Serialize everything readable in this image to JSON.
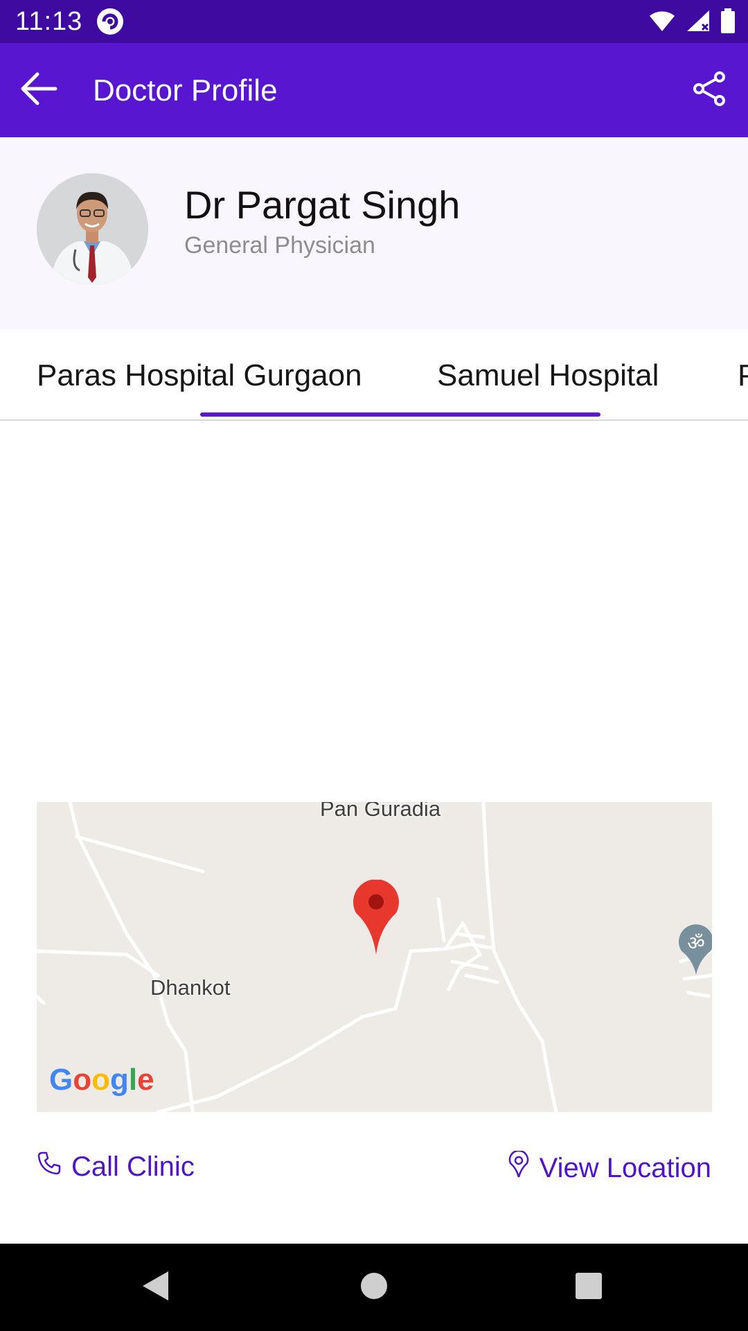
{
  "status_bar": {
    "time": "11:13",
    "icons": [
      "app-notification-icon",
      "wifi-icon",
      "signal-icon",
      "battery-icon"
    ]
  },
  "app_bar": {
    "title": "Doctor Profile",
    "icons": [
      "back-arrow-icon",
      "share-icon"
    ]
  },
  "doctor": {
    "name": "Dr Pargat Singh",
    "specialty": "General Physician"
  },
  "tabs": {
    "items": [
      "Paras Hospital Gurgaon",
      "Samuel Hospital",
      "P"
    ],
    "selected": "Samuel Hospital"
  },
  "map": {
    "labels": [
      "Pan Guradia",
      "Dhankot"
    ],
    "logo": "Google",
    "marker": "red-map-pin",
    "poi_icon": "temple-om-icon"
  },
  "actions": {
    "call": "Call Clinic",
    "location": "View Location"
  },
  "nav_bar": {
    "icons": [
      "back-triangle-icon",
      "home-circle-icon",
      "recents-square-icon"
    ]
  },
  "colors": {
    "status_bar": "#3f0aa0",
    "app_bar": "#5816d0",
    "accent": "#5014c8",
    "profile_bg": "#f9f6fd",
    "map_bg": "#eeebe6"
  }
}
